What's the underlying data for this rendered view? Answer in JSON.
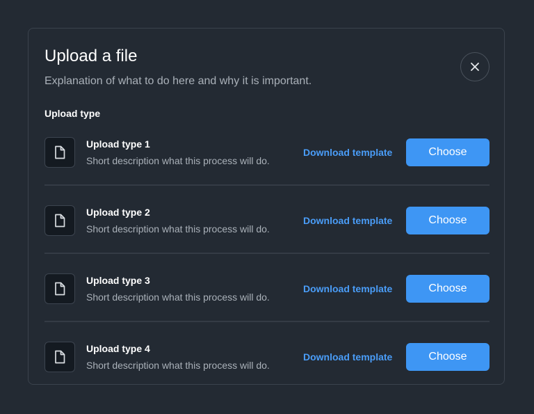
{
  "modal": {
    "title": "Upload a file",
    "subtitle": "Explanation of what to do here and why it is important.",
    "close_icon": "close-icon",
    "section_label": "Upload type"
  },
  "rows": [
    {
      "name": "Upload type 1",
      "description": "Short description what this process will do.",
      "download_label": "Download template",
      "choose_label": "Choose",
      "icon": "file-icon"
    },
    {
      "name": "Upload type 2",
      "description": "Short description what this process will do.",
      "download_label": "Download template",
      "choose_label": "Choose",
      "icon": "file-icon"
    },
    {
      "name": "Upload type 3",
      "description": "Short description what this process will do.",
      "download_label": "Download template",
      "choose_label": "Choose",
      "icon": "file-icon"
    },
    {
      "name": "Upload type 4",
      "description": "Short description what this process will do.",
      "download_label": "Download template",
      "choose_label": "Choose",
      "icon": "file-icon"
    }
  ],
  "colors": {
    "background": "#232a33",
    "accent": "#3e96f4",
    "link": "#4a9df8",
    "muted_text": "#aab1b9"
  }
}
